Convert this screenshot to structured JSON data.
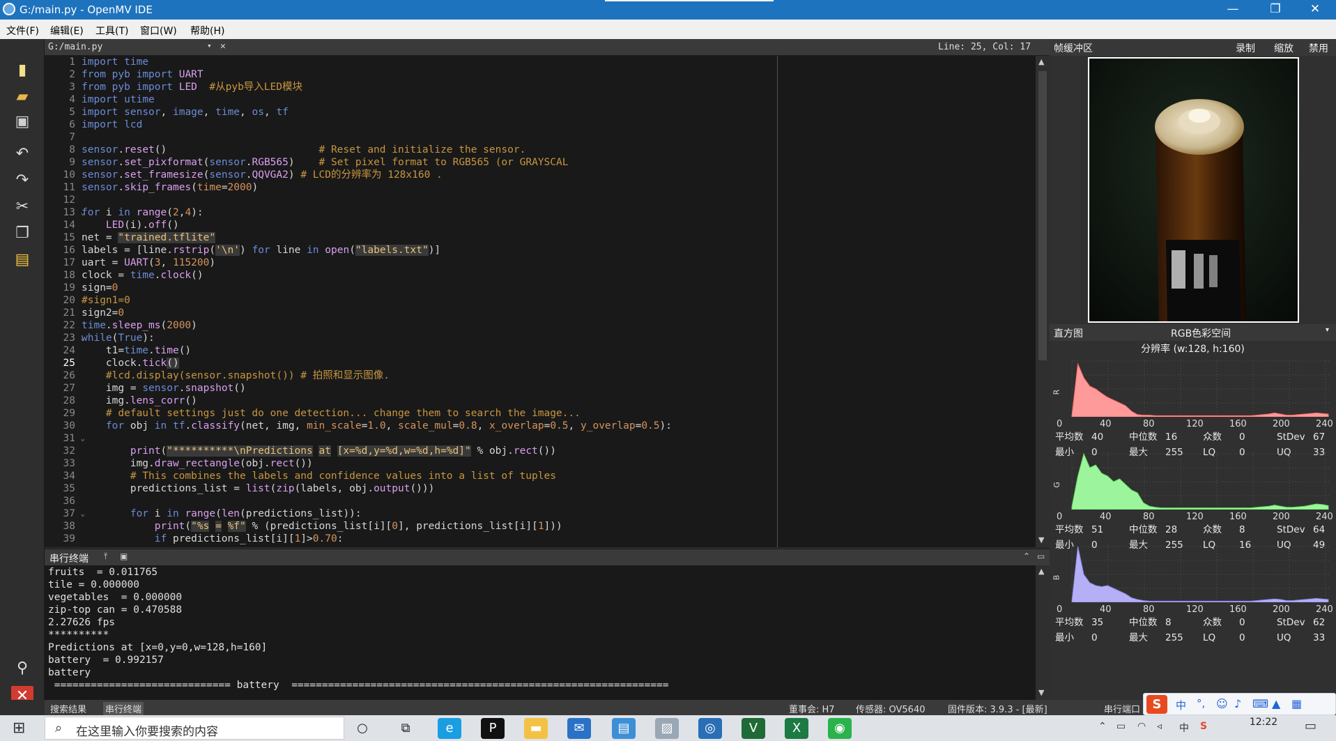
{
  "window": {
    "title": "G:/main.py - OpenMV IDE",
    "minimize": "—",
    "restore": "❐",
    "close": "✕"
  },
  "menu": [
    {
      "label": "文件(F)"
    },
    {
      "label": "编辑(E)"
    },
    {
      "label": "工具(T)"
    },
    {
      "label": "窗口(W)"
    },
    {
      "label": "帮助(H)"
    }
  ],
  "editor": {
    "file": "G:/main.py",
    "dropdown": "▾",
    "close": "✕",
    "position": "Line: 25, Col: 17",
    "lines": [
      {
        "n": "1",
        "html": "<span class='kw'>import</span> <span class='mod'>time</span>"
      },
      {
        "n": "2",
        "html": "<span class='kw'>from</span> <span class='mod'>pyb</span> <span class='kw'>import</span> <span class='fn'>UART</span>"
      },
      {
        "n": "3",
        "html": "<span class='kw'>from</span> <span class='mod'>pyb</span> <span class='kw'>import</span> <span class='fn'>LED</span>  <span class='com'>#从pyb导入LED模块</span>"
      },
      {
        "n": "4",
        "html": "<span class='kw'>import</span> <span class='mod'>utime</span>"
      },
      {
        "n": "5",
        "html": "<span class='kw'>import</span> <span class='mod'>sensor</span>, <span class='mod'>image</span>, <span class='mod'>time</span>, <span class='mod'>os</span>, <span class='mod'>tf</span>"
      },
      {
        "n": "6",
        "html": "<span class='kw'>import</span> <span class='mod'>lcd</span>"
      },
      {
        "n": "7",
        "html": ""
      },
      {
        "n": "8",
        "html": "<span class='mod'>sensor</span>.<span class='fn'>reset</span>()                         <span class='com'># Reset and initialize the sensor.</span>"
      },
      {
        "n": "9",
        "html": "<span class='mod'>sensor</span>.<span class='fn'>set_pixformat</span>(<span class='mod'>sensor</span>.<span class='fn'>RGB565</span>)    <span class='com'># Set pixel format to RGB565 (or GRAYSCAL</span>"
      },
      {
        "n": "10",
        "html": "<span class='mod'>sensor</span>.<span class='fn'>set_framesize</span>(<span class='mod'>sensor</span>.<span class='fn'>QQVGA2</span>) <span class='com'># LCD的分辨率为 128x160 .</span>"
      },
      {
        "n": "11",
        "html": "<span class='mod'>sensor</span>.<span class='fn'>skip_frames</span>(<span class='num'>time</span>=<span class='num'>2000</span>)"
      },
      {
        "n": "12",
        "html": ""
      },
      {
        "n": "13",
        "html": "<span class='kw'>for</span> i <span class='kw'>in</span> <span class='fn'>range</span>(<span class='num'>2</span>,<span class='num'>4</span>):",
        "fold": true
      },
      {
        "n": "14",
        "html": "    <span class='fn'>LED</span>(i).<span class='fn'>off</span>()"
      },
      {
        "n": "15",
        "html": "net = <span class='str'>\"trained.tflite\"</span>"
      },
      {
        "n": "16",
        "html": "labels = [line.<span class='fn'>rstrip</span>(<span class='str'>'\\n'</span>) <span class='kw'>for</span> line <span class='kw'>in</span> <span class='fn'>open</span>(<span class='str'>\"labels.txt\"</span>)]"
      },
      {
        "n": "17",
        "html": "uart = <span class='fn'>UART</span>(<span class='num'>3</span>, <span class='num'>115200</span>)"
      },
      {
        "n": "18",
        "html": "clock = <span class='mod'>time</span>.<span class='fn'>clock</span>()"
      },
      {
        "n": "19",
        "html": "sign=<span class='num'>0</span>"
      },
      {
        "n": "20",
        "html": "<span class='com'>#sign1=0</span>"
      },
      {
        "n": "21",
        "html": "sign2=<span class='num'>0</span>"
      },
      {
        "n": "22",
        "html": "<span class='mod'>time</span>.<span class='fn'>sleep_ms</span>(<span class='num'>2000</span>)"
      },
      {
        "n": "23",
        "html": "<span class='kw'>while</span>(<span class='kw'>True</span>):",
        "fold": true
      },
      {
        "n": "24",
        "html": "    t1=<span class='mod'>time</span>.<span class='fn'>time</span>()"
      },
      {
        "n": "25",
        "html": "    clock.<span class='fn'>tick</span><span class='hl'>()</span>"
      },
      {
        "n": "26",
        "html": "    <span class='com'>#lcd.display(sensor.snapshot()) # 拍照和显示图像.</span>"
      },
      {
        "n": "27",
        "html": "    img = <span class='mod'>sensor</span>.<span class='fn'>snapshot</span>()"
      },
      {
        "n": "28",
        "html": "    img.<span class='fn'>lens_corr</span>()"
      },
      {
        "n": "29",
        "html": "    <span class='com'># default settings just do one detection... change them to search the image...</span>"
      },
      {
        "n": "30",
        "html": "    <span class='kw'>for</span> obj <span class='kw'>in</span> <span class='mod'>tf</span>.<span class='fn'>classify</span>(net, img, <span class='num'>min_scale</span>=<span class='num'>1.0</span>, <span class='num'>scale_mul</span>=<span class='num'>0.8</span>, <span class='num'>x_overlap</span>=<span class='num'>0.5</span>, <span class='num'>y_overlap</span>=<span class='num'>0.5</span>):"
      },
      {
        "n": "31",
        "html": "",
        "fold": true
      },
      {
        "n": "32",
        "html": "        <span class='fn'>print</span>(<span class='str'>\"**********\\nPredictions</span> <span class='str'>at</span> <span class='str'>[x=%d,y=%d,w=%d,h=%d]\"</span> % obj.<span class='fn'>rect</span>())"
      },
      {
        "n": "33",
        "html": "        img.<span class='fn'>draw_rectangle</span>(obj.<span class='fn'>rect</span>())"
      },
      {
        "n": "34",
        "html": "        <span class='com'># This combines the labels and confidence values into a list of tuples</span>"
      },
      {
        "n": "35",
        "html": "        predictions_list = <span class='fn'>list</span>(<span class='fn'>zip</span>(labels, obj.<span class='fn'>output</span>()))"
      },
      {
        "n": "36",
        "html": ""
      },
      {
        "n": "37",
        "html": "        <span class='kw'>for</span> i <span class='kw'>in</span> <span class='fn'>range</span>(<span class='fn'>len</span>(predictions_list)):",
        "fold": true
      },
      {
        "n": "38",
        "html": "            <span class='fn'>print</span>(<span class='str'>\"%s</span> <span class='str'>=</span> <span class='str'>%f\"</span> % (predictions_list[i][<span class='num'>0</span>], predictions_list[i][<span class='num'>1</span>]))"
      },
      {
        "n": "39",
        "html": "            <span class='kw'>if</span> predictions_list[i][<span class='num'>1</span>]&gt;<span class='num'>0.70</span>:"
      }
    ]
  },
  "terminal": {
    "title": "串行终端",
    "lines": [
      "fruits  = 0.011765",
      "tile = 0.000000",
      "vegetables  = 0.000000",
      "zip-top can = 0.470588",
      "2.27626 fps",
      "**********",
      "Predictions at [x=0,y=0,w=128,h=160]",
      "battery  = 0.992157",
      "battery",
      " ============================= battery  =============================================================="
    ]
  },
  "status": {
    "tab_search": "搜索结果",
    "tab_serial": "串行终端",
    "board": "董事会: H7",
    "sensor": "传感器: OV5640",
    "firmware": "固件版本: 3.9.3 - [最新]",
    "port": "串行端口"
  },
  "framebuffer": {
    "title": "帧缓冲区",
    "record": "录制",
    "zoom": "缩放",
    "disable": "禁用"
  },
  "histogram": {
    "title": "直方图",
    "colorspace": "RGB色彩空间",
    "resolution": "分辨率 (w:128, h:160)",
    "ticks": [
      "0",
      "40",
      "80",
      "120",
      "160",
      "200",
      "240"
    ],
    "channels": [
      {
        "name": "R",
        "color": "#ff9a9a",
        "stroke": "#ff6b6b",
        "mean": "40",
        "median": "16",
        "mode": "0",
        "stdev": "67",
        "min": "0",
        "max": "255",
        "lq": "0",
        "uq": "33",
        "values": [
          0.02,
          0.95,
          0.7,
          0.55,
          0.5,
          0.42,
          0.35,
          0.3,
          0.25,
          0.2,
          0.1,
          0.04,
          0.03,
          0.03,
          0.02,
          0.02,
          0.02,
          0.02,
          0.02,
          0.02,
          0.02,
          0.02,
          0.02,
          0.02,
          0.02,
          0.02,
          0.02,
          0.02,
          0.02,
          0.02,
          0.02,
          0.03,
          0.04,
          0.05,
          0.07,
          0.05,
          0.03,
          0.03,
          0.04,
          0.05,
          0.06,
          0.07,
          0.06,
          0.05
        ]
      },
      {
        "name": "G",
        "color": "#9cf59c",
        "stroke": "#5ddc5d",
        "mean": "51",
        "median": "28",
        "mode": "8",
        "stdev": "64",
        "min": "0",
        "max": "255",
        "lq": "16",
        "uq": "49",
        "values": [
          0.05,
          0.6,
          1.0,
          0.75,
          0.8,
          0.65,
          0.6,
          0.5,
          0.55,
          0.45,
          0.35,
          0.3,
          0.12,
          0.06,
          0.04,
          0.03,
          0.03,
          0.03,
          0.03,
          0.03,
          0.03,
          0.03,
          0.03,
          0.03,
          0.03,
          0.03,
          0.03,
          0.03,
          0.03,
          0.03,
          0.03,
          0.04,
          0.05,
          0.06,
          0.08,
          0.06,
          0.04,
          0.04,
          0.05,
          0.06,
          0.08,
          0.1,
          0.09,
          0.07
        ]
      },
      {
        "name": "B",
        "color": "#b5b0f5",
        "stroke": "#8a84e8",
        "mean": "35",
        "median": "8",
        "mode": "0",
        "stdev": "62",
        "min": "0",
        "max": "255",
        "lq": "0",
        "uq": "33",
        "values": [
          0.02,
          1.0,
          0.5,
          0.35,
          0.3,
          0.28,
          0.3,
          0.25,
          0.2,
          0.15,
          0.08,
          0.05,
          0.03,
          0.02,
          0.02,
          0.02,
          0.02,
          0.02,
          0.02,
          0.02,
          0.02,
          0.02,
          0.02,
          0.02,
          0.02,
          0.02,
          0.02,
          0.02,
          0.02,
          0.02,
          0.02,
          0.03,
          0.04,
          0.05,
          0.06,
          0.05,
          0.03,
          0.03,
          0.04,
          0.05,
          0.06,
          0.07,
          0.06,
          0.05
        ]
      }
    ],
    "labels": {
      "mean": "平均数",
      "median": "中位数",
      "mode": "众数",
      "stdev": "StDev",
      "min": "最小",
      "max": "最大",
      "lq": "LQ",
      "uq": "UQ"
    }
  },
  "taskbar": {
    "search_placeholder": "在这里输入你要搜索的内容",
    "time": "12:22",
    "ime": "中"
  }
}
